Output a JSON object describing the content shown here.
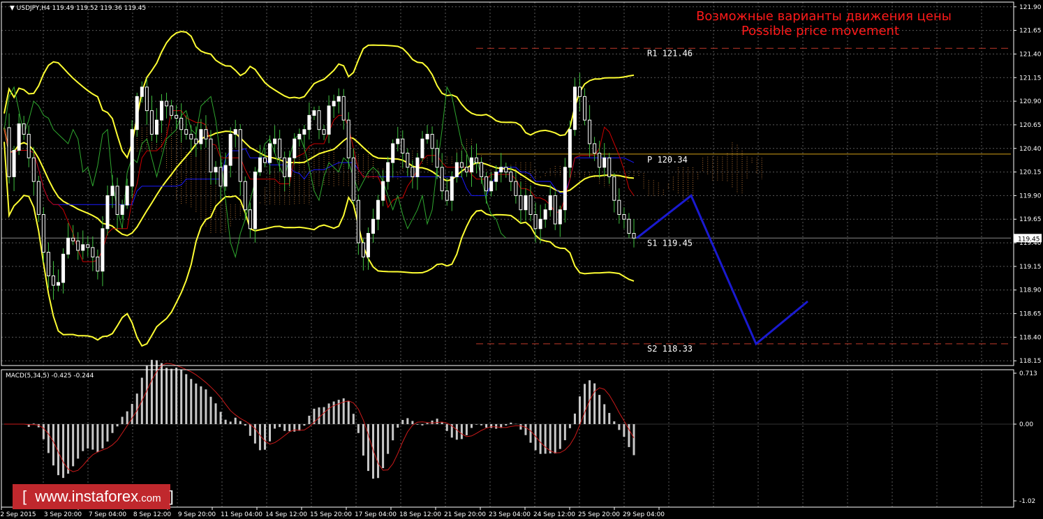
{
  "header": {
    "symbol_label": "USDJPY,H4",
    "ohlc": "119.49 119.52 119.36 119.45"
  },
  "annotation": {
    "title_ru": "Возможные варианты движения цены",
    "title_en": "Possible price movement",
    "color": "#ff1a1a"
  },
  "levels": [
    {
      "name": "R1",
      "label": "R1 121.46",
      "value": 121.46,
      "color": "#c0392b",
      "style": "dashed",
      "x_start": "12 Sep 20:00"
    },
    {
      "name": "P",
      "label": "P 120.34",
      "value": 120.34,
      "color": "#d4a017",
      "style": "solid",
      "x_start": "12 Sep 20:00"
    },
    {
      "name": "S1",
      "label": "S1 119.45",
      "value": 119.45,
      "color": "#888888",
      "style": "solid",
      "x_start": "2 Sep 2015"
    },
    {
      "name": "S2",
      "label": "S2 118.33",
      "value": 118.33,
      "color": "#c0392b",
      "style": "dashed",
      "x_start": "12 Sep 20:00"
    }
  ],
  "current_price": "119.45",
  "price_axis": [
    "121.90",
    "121.65",
    "121.40",
    "121.15",
    "120.90",
    "120.65",
    "120.40",
    "120.15",
    "119.90",
    "119.65",
    "119.40",
    "119.15",
    "118.90",
    "118.65",
    "118.40",
    "118.15"
  ],
  "time_axis": [
    "2 Sep 2015",
    "3 Sep 20:00",
    "7 Sep 04:00",
    "8 Sep 12:00",
    "9 Sep 20:00",
    "11 Sep 04:00",
    "14 Sep 12:00",
    "15 Sep 20:00",
    "17 Sep 04:00",
    "18 Sep 12:00",
    "21 Sep 20:00",
    "23 Sep 04:00",
    "24 Sep 12:00",
    "25 Sep 20:00",
    "29 Sep 04:00"
  ],
  "macd": {
    "label": "MACD(5,34,5) -0.425 -0.244",
    "axis": [
      "0.713",
      "0.00",
      "-1.02"
    ]
  },
  "logo": {
    "bracket_open": "[",
    "text": "www.instaforex",
    "suffix": ".com",
    "bracket_close": "]"
  },
  "colors": {
    "background": "#000000",
    "grid": "#5a5a5a",
    "candle_bull": "#ffffff",
    "candle_bear": "#ffffff",
    "wick": "#3fbf3f",
    "bollinger": "#ffff33",
    "kijun": "#1a1aff",
    "tenkan": "#cc0000",
    "chikou": "#2fa82f",
    "cloud": "#b87333",
    "forecast": "#1a1ad0",
    "macd_hist": "#c8c8c8",
    "macd_signal": "#cc1a1a"
  },
  "chart_data": {
    "type": "candlestick",
    "symbol": "USDJPY",
    "timeframe": "H4",
    "ylim": [
      118.1,
      121.95
    ],
    "close_series": [
      120.62,
      120.1,
      120.38,
      120.66,
      120.55,
      120.3,
      120.05,
      119.7,
      119.3,
      119.05,
      118.95,
      118.98,
      119.28,
      119.45,
      119.42,
      119.32,
      119.38,
      119.35,
      119.25,
      119.1,
      119.55,
      119.9,
      120.0,
      119.7,
      119.8,
      120.0,
      120.6,
      120.95,
      121.05,
      120.8,
      120.55,
      120.7,
      120.9,
      120.85,
      120.75,
      120.72,
      120.6,
      120.55,
      120.5,
      120.45,
      120.6,
      120.5,
      120.15,
      120.2,
      120.0,
      120.22,
      120.55,
      120.6,
      120.05,
      119.75,
      119.55,
      120.15,
      120.3,
      120.25,
      120.45,
      120.5,
      120.3,
      120.1,
      120.3,
      120.5,
      120.55,
      120.6,
      120.75,
      120.8,
      120.6,
      120.55,
      120.85,
      120.9,
      120.95,
      120.7,
      120.3,
      119.85,
      119.4,
      119.25,
      119.5,
      119.65,
      119.85,
      120.05,
      120.25,
      120.45,
      120.5,
      120.35,
      120.2,
      120.1,
      120.3,
      120.5,
      120.55,
      120.4,
      120.2,
      119.95,
      119.85,
      120.1,
      120.25,
      120.2,
      120.15,
      120.3,
      120.25,
      120.1,
      119.95,
      120.05,
      120.15,
      120.2,
      120.15,
      120.05,
      119.9,
      119.75,
      119.9,
      119.7,
      119.55,
      119.65,
      119.75,
      119.9,
      119.6,
      119.75,
      120.2,
      120.6,
      121.05,
      120.95,
      120.7,
      120.45,
      120.35,
      120.2,
      120.3,
      120.1,
      119.85,
      119.7,
      119.65,
      119.5,
      119.45
    ],
    "forecast_path": [
      {
        "x": "29 Sep 12:00",
        "y": 119.45
      },
      {
        "x": "30 Sep 00:00",
        "y": 119.9
      },
      {
        "x": "1 Oct 16:00",
        "y": 118.33
      },
      {
        "x": "2 Oct 12:00",
        "y": 118.78
      }
    ],
    "macd_signal_last": -0.244,
    "macd_main_last": -0.425
  }
}
